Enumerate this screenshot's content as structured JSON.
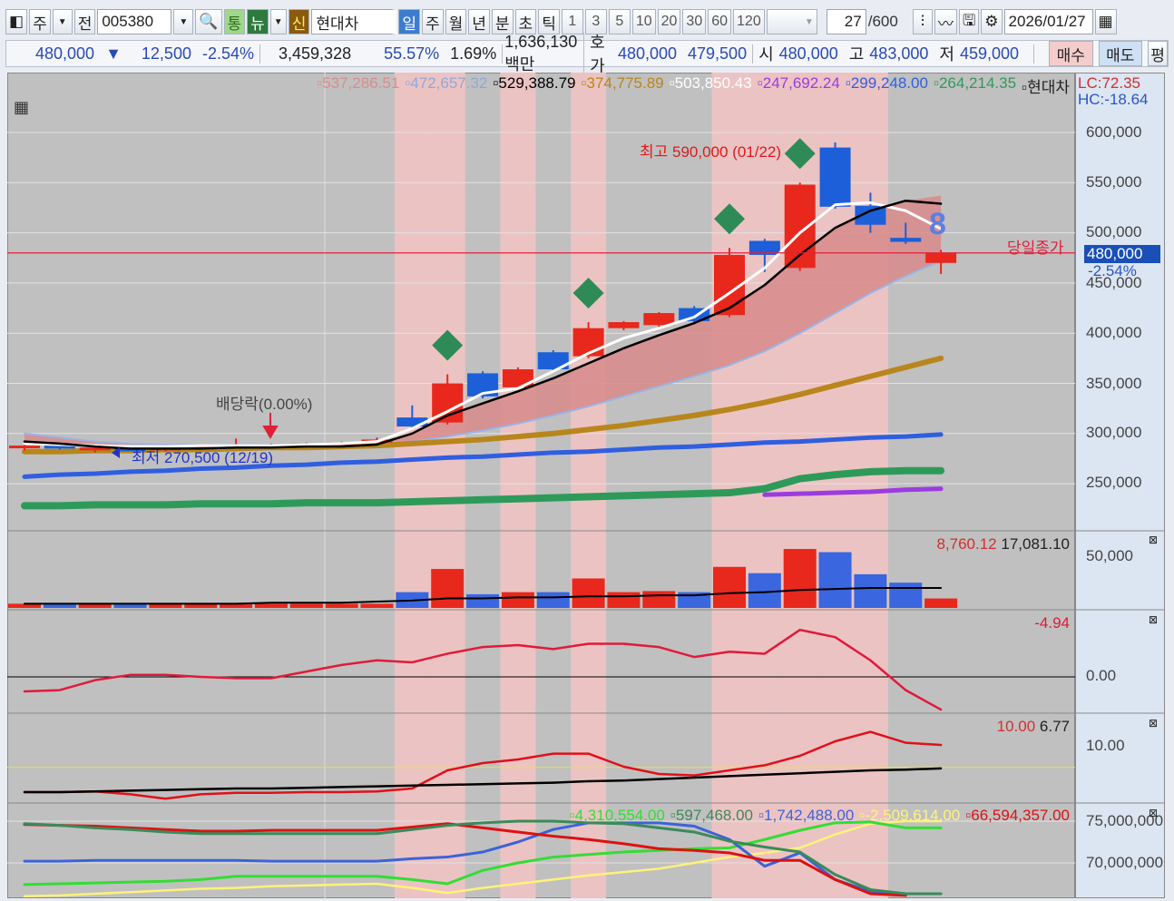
{
  "toolbar": {
    "market": "주",
    "prev": "전",
    "code": "005380",
    "tong": "통",
    "new": "뉴",
    "shin": "신",
    "name": "현대차",
    "periods": [
      "일",
      "주",
      "월",
      "년",
      "분",
      "초",
      "틱"
    ],
    "intervals": [
      "1",
      "3",
      "5",
      "10",
      "20",
      "30",
      "60",
      "120"
    ],
    "count": "27",
    "count_max": "/600",
    "date": "2026/01/27"
  },
  "quote": {
    "price": "480,000",
    "arrow": "▼",
    "change": "12,500",
    "change_pct": "-2.54%",
    "volume": "3,459,328",
    "ratio": "55.57%",
    "turnover": "1.69%",
    "amount": "1,636,130백만",
    "hoga_label": "호가",
    "ask": "480,000",
    "bid": "479,500",
    "open_label": "시",
    "open": "480,000",
    "high_label": "고",
    "high": "483,000",
    "low_label": "저",
    "low": "459,000",
    "buy": "매수",
    "sell": "매도",
    "avg": "평"
  },
  "legend_main": [
    {
      "text": "537,286.51",
      "color": "#d98c8c"
    },
    {
      "text": "472,657.32",
      "color": "#8fa8d8"
    },
    {
      "text": "529,388.79",
      "color": "#000000"
    },
    {
      "text": "374,775.89",
      "color": "#b8861c"
    },
    {
      "text": "503,850.43",
      "color": "#ffffff"
    },
    {
      "text": "247,692.24",
      "color": "#9a3ce0"
    },
    {
      "text": "299,248.00",
      "color": "#2f5ee0"
    },
    {
      "text": "264,214.35",
      "color": "#2e9a5a"
    },
    {
      "text": "현대차",
      "color": "#222222"
    }
  ],
  "lc": "LC:72.35",
  "hc": "HC:-18.64",
  "annotations": {
    "high": "최고 590,000 (01/22)",
    "low": "최저 270,500 (12/19)",
    "dividend": "배당락(0.00%)",
    "today_close": "당일종가",
    "signal": "8"
  },
  "price_axis": {
    "labels": [
      "600,000",
      "550,000",
      "500,000",
      "450,000",
      "400,000",
      "350,000",
      "300,000",
      "250,000"
    ],
    "current": "480,000",
    "current_pct": "-2.54%"
  },
  "volume_legend": [
    "8,760.12",
    "17,081.10"
  ],
  "volume_axis": "50,000",
  "osc_legend": "-4.94",
  "osc_axis": "0.00",
  "p4_legend": [
    "10.00",
    "6.77"
  ],
  "p4_axis": "10.00",
  "p5_legend": [
    {
      "text": "4,310,554.00",
      "color": "#33dd33"
    },
    {
      "text": "597,468.00",
      "color": "#3a8a5a"
    },
    {
      "text": "1,742,488.00",
      "color": "#3c63d8"
    },
    {
      "text": "-2,509,614.00",
      "color": "#fff27a"
    },
    {
      "text": "66,594,357.00",
      "color": "#dd1111"
    }
  ],
  "p5_axis": [
    "75,000,000",
    "70,000,000"
  ],
  "chart_data": {
    "type": "candlestick",
    "bars": 27,
    "highlight_bars": [
      11,
      12,
      14,
      16,
      20,
      21,
      22,
      23,
      24
    ],
    "signals": [
      12,
      16,
      20,
      22
    ],
    "ohlc": [
      [
        286,
        289,
        283,
        288
      ],
      [
        288,
        290,
        284,
        285
      ],
      [
        284,
        287,
        281,
        286
      ],
      [
        285,
        287,
        283,
        284
      ],
      [
        284,
        287,
        282,
        286
      ],
      [
        286,
        289,
        284,
        287
      ],
      [
        287,
        295,
        285,
        288
      ],
      [
        288,
        290,
        286,
        289
      ],
      [
        289,
        291,
        287,
        290
      ],
      [
        290,
        292,
        288,
        291
      ],
      [
        291,
        296,
        289,
        294
      ],
      [
        316,
        328,
        305,
        307
      ],
      [
        311,
        359,
        309,
        350
      ],
      [
        360,
        362,
        335,
        337
      ],
      [
        346,
        366,
        344,
        364
      ],
      [
        381,
        383,
        362,
        364
      ],
      [
        377,
        411,
        375,
        405
      ],
      [
        405,
        412,
        403,
        411
      ],
      [
        408,
        421,
        406,
        420
      ],
      [
        425,
        427,
        410,
        412
      ],
      [
        418,
        485,
        416,
        478
      ],
      [
        492,
        494,
        461,
        478
      ],
      [
        465,
        550,
        462,
        548
      ],
      [
        585,
        590,
        524,
        526
      ],
      [
        527,
        540,
        500,
        508
      ],
      [
        495,
        510,
        489,
        491
      ],
      [
        470,
        483,
        459,
        480
      ]
    ],
    "ma_white": [
      290,
      289,
      288,
      287,
      287,
      288,
      288,
      288,
      289,
      290,
      292,
      305,
      322,
      340,
      345,
      362,
      380,
      395,
      405,
      416,
      440,
      465,
      500,
      528,
      530,
      522,
      504
    ],
    "ma_black": [
      292,
      290,
      287,
      285,
      285,
      285,
      286,
      286,
      287,
      287,
      289,
      300,
      318,
      330,
      342,
      355,
      370,
      385,
      398,
      410,
      425,
      448,
      478,
      505,
      522,
      532,
      529
    ],
    "band_upper": [
      293,
      291,
      289,
      287,
      287,
      287,
      288,
      288,
      289,
      289,
      291,
      300,
      318,
      330,
      342,
      355,
      370,
      385,
      398,
      410,
      425,
      448,
      478,
      505,
      522,
      532,
      537
    ],
    "band_lower": [
      300,
      296,
      292,
      290,
      289,
      289,
      289,
      289,
      290,
      290,
      291,
      292,
      297,
      303,
      310,
      318,
      327,
      337,
      347,
      357,
      368,
      382,
      400,
      420,
      440,
      457,
      472
    ],
    "ma_gold": [
      282,
      282,
      283,
      283,
      284,
      284,
      285,
      286,
      286,
      287,
      288,
      290,
      292,
      294,
      297,
      300,
      304,
      308,
      313,
      318,
      324,
      331,
      339,
      348,
      357,
      366,
      375
    ],
    "ma_blue": [
      257,
      259,
      260,
      262,
      263,
      265,
      266,
      268,
      269,
      271,
      272,
      274,
      276,
      277,
      279,
      281,
      282,
      284,
      286,
      287,
      289,
      291,
      292,
      294,
      296,
      297,
      299
    ],
    "ma_green": [
      228,
      228,
      229,
      229,
      229,
      230,
      230,
      230,
      231,
      231,
      231,
      232,
      233,
      234,
      235,
      236,
      237,
      238,
      239,
      240,
      241,
      245,
      255,
      259,
      262,
      263,
      263
    ],
    "ma_purple": [
      null,
      null,
      null,
      null,
      null,
      null,
      null,
      null,
      null,
      null,
      null,
      null,
      null,
      null,
      null,
      null,
      null,
      null,
      null,
      null,
      null,
      239,
      240,
      241,
      242,
      244,
      245
    ],
    "volume": [
      4,
      4,
      4,
      4,
      4,
      4,
      4,
      4,
      4,
      4,
      4,
      15,
      37,
      13,
      15,
      15,
      28,
      15,
      16,
      15,
      39,
      33,
      56,
      53,
      32,
      24,
      9
    ],
    "volume_ma": [
      4,
      4,
      4,
      4,
      4,
      4,
      4,
      5,
      5,
      5,
      6,
      7,
      9,
      9,
      10,
      10,
      11,
      11,
      12,
      12,
      14,
      15,
      17,
      18,
      19,
      19,
      19
    ],
    "osc": [
      -2.2,
      -2.0,
      -0.5,
      0.3,
      0.3,
      0.0,
      -0.2,
      -0.2,
      0.8,
      1.8,
      2.5,
      2.2,
      3.5,
      4.5,
      4.8,
      4.2,
      5.0,
      5.0,
      4.5,
      3.0,
      3.8,
      3.5,
      7.1,
      6.0,
      2.5,
      -2.0,
      -4.94
    ],
    "p4_red": [
      3.5,
      3.5,
      3.6,
      3.2,
      2.6,
      3.2,
      3.4,
      3.4,
      3.5,
      3.5,
      3.6,
      4.0,
      6.5,
      7.5,
      8.0,
      8.8,
      8.8,
      7.0,
      6.0,
      5.8,
      6.5,
      7.2,
      8.5,
      10.5,
      11.8,
      10.3,
      10.0
    ],
    "p4_black": [
      3.5,
      3.5,
      3.6,
      3.7,
      3.8,
      3.9,
      4.0,
      4.0,
      4.1,
      4.2,
      4.3,
      4.4,
      4.5,
      4.6,
      4.7,
      4.8,
      5.0,
      5.1,
      5.3,
      5.5,
      5.7,
      5.9,
      6.1,
      6.3,
      6.5,
      6.6,
      6.77
    ],
    "p4_reference": 6.9,
    "p5_bright_green": [
      67.4,
      67.5,
      67.6,
      67.7,
      67.8,
      68.0,
      68.4,
      68.4,
      68.4,
      68.4,
      68.4,
      68.0,
      67.5,
      69.1,
      70.0,
      70.7,
      71.0,
      71.3,
      71.5,
      71.7,
      71.8,
      72.8,
      73.9,
      74.8,
      74.9,
      74.2,
      74.2
    ],
    "p5_yellow": [
      66.0,
      66.1,
      66.3,
      66.5,
      66.7,
      66.9,
      67.0,
      67.2,
      67.3,
      67.4,
      67.5,
      67.0,
      66.4,
      67.0,
      67.5,
      68.0,
      68.5,
      68.9,
      69.3,
      70.0,
      70.7,
      71.2,
      71.8,
      73.4,
      74.7,
      75.0,
      75.0
    ],
    "p5_blue": [
      70.2,
      70.2,
      70.3,
      70.3,
      70.3,
      70.3,
      70.3,
      70.2,
      70.2,
      70.2,
      70.2,
      70.5,
      70.7,
      71.3,
      72.5,
      74.0,
      74.8,
      74.8,
      74.8,
      74.4,
      72.8,
      69.6,
      71.2,
      68.0,
      66.6,
      66.3,
      null
    ],
    "p5_red": [
      74.6,
      74.5,
      74.4,
      74.2,
      74.0,
      73.8,
      73.8,
      73.9,
      73.9,
      73.9,
      73.9,
      74.3,
      74.7,
      74.2,
      73.7,
      73.2,
      72.8,
      72.3,
      71.7,
      71.5,
      71.2,
      70.3,
      70.3,
      68.0,
      66.3,
      66.1,
      null
    ],
    "p5_dark_green": [
      74.7,
      74.5,
      74.2,
      74.0,
      73.7,
      73.5,
      73.5,
      73.5,
      73.5,
      73.5,
      73.5,
      74.0,
      74.5,
      74.8,
      75.0,
      75.0,
      74.8,
      74.7,
      74.2,
      73.7,
      72.6,
      71.9,
      71.3,
      68.6,
      66.8,
      66.3,
      66.3
    ]
  }
}
